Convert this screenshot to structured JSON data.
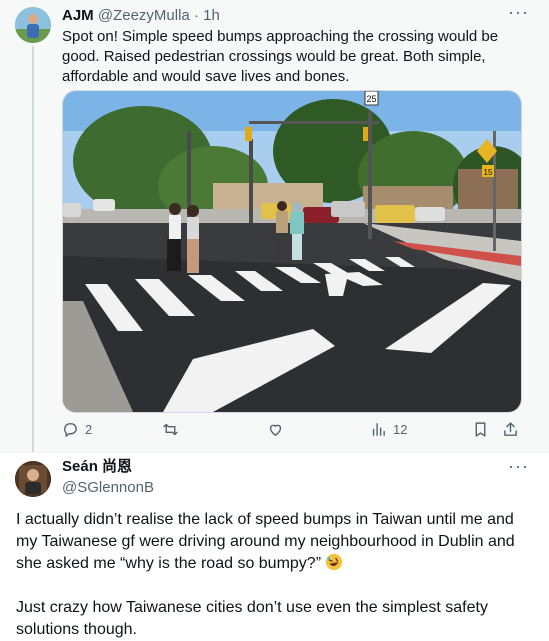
{
  "tweet1": {
    "author_name": "AJM",
    "author_handle": "@ZeezyMulla",
    "separator": "·",
    "time": "1h",
    "more": "···",
    "text": "Spot on! Simple speed bumps approaching the crossing would be good. Raised pedestrian crossings would be great. Both simple, affordable and would save lives and bones.",
    "image_signs": {
      "top_sign": "25",
      "side_sign": "15"
    },
    "actions": {
      "reply_count": "2",
      "retweet_count": "",
      "like_count": "",
      "views_count": "12"
    }
  },
  "tweet2": {
    "author_name": "Seán 尚恩",
    "author_handle": "@SGlennonB",
    "more": "···",
    "text_p1": "I actually didn’t realise the lack of speed bumps in Taiwan until me and my Taiwanese gf were driving around my neighbourhood in Dublin and she asked me “why is the road so bumpy?” ",
    "text_p2": "Just crazy how Taiwanese cities don’t use even the simplest safety solutions though."
  },
  "colors": {
    "link_blue": "#1d9bf0",
    "muted_gray": "#536471",
    "text": "#0f1419",
    "thread_bg": "#f7f9f9"
  },
  "icons": [
    "reply-icon",
    "retweet-icon",
    "like-icon",
    "views-icon",
    "bookmark-icon",
    "share-icon"
  ]
}
